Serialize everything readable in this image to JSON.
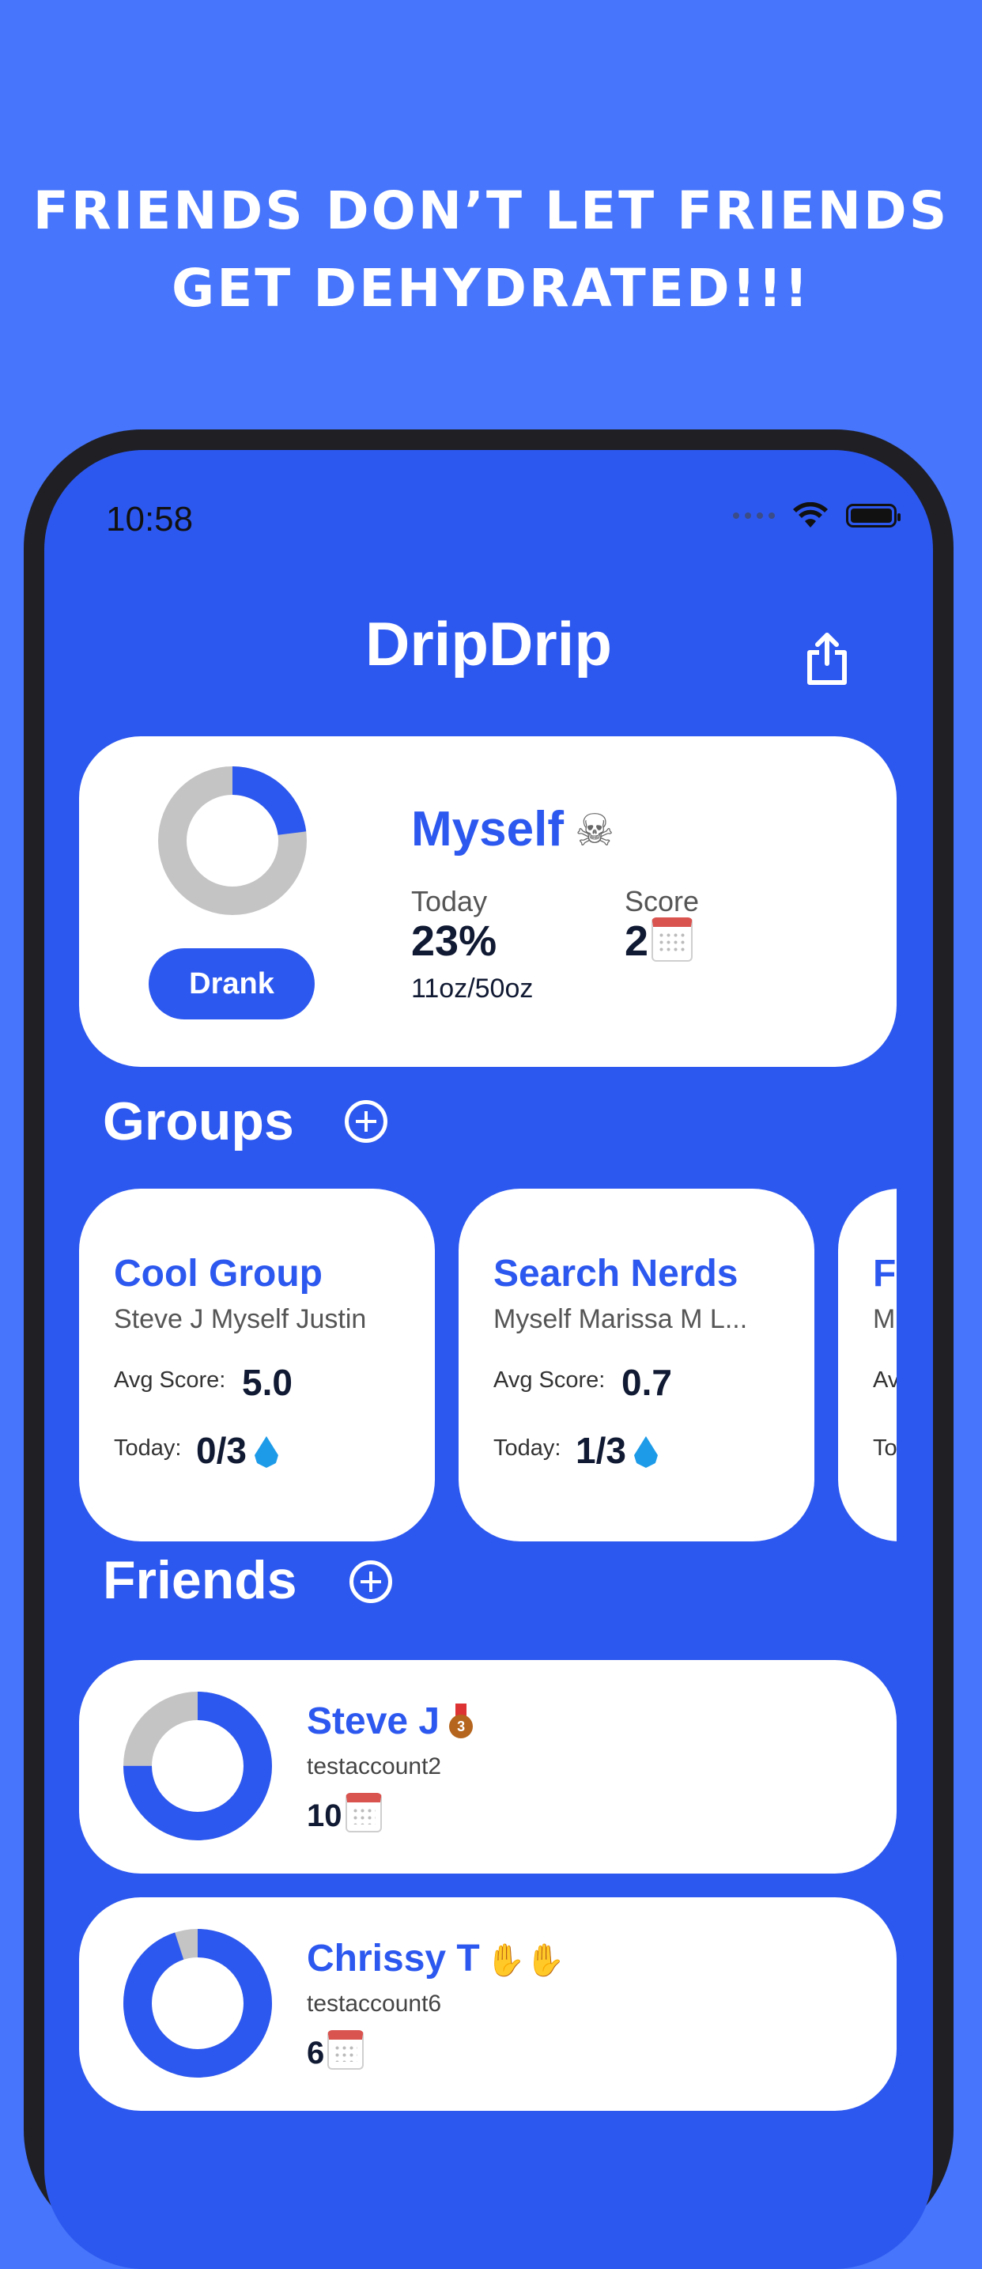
{
  "headline": {
    "line1": "FRIENDS DON’T LET FRIENDS",
    "line2": "GET DEHYDRATED!!!"
  },
  "status_bar": {
    "time": "10:58",
    "icons": [
      "signal-icon",
      "wifi-icon",
      "battery-icon"
    ]
  },
  "header": {
    "title": "DripDrip",
    "share_icon": "share-icon"
  },
  "me": {
    "name": "Myself",
    "emoji": "☠",
    "today_label": "Today",
    "today_percent": "23%",
    "today_progress": 0.23,
    "today_amount": "11oz/50oz",
    "score_label": "Score",
    "score_value": "2",
    "drank_button": "Drank"
  },
  "groups": {
    "title": "Groups",
    "items": [
      {
        "name": "Cool Group",
        "members": "Steve J Myself Justin",
        "avg_label": "Avg Score:",
        "avg": "5.0",
        "today_label": "Today:",
        "today": "0/3"
      },
      {
        "name": "Search Nerds",
        "members": "Myself Marissa M L...",
        "avg_label": "Avg Score:",
        "avg": "0.7",
        "today_label": "Today:",
        "today": "1/3"
      },
      {
        "name": "F",
        "members": "M",
        "avg_label": "Av",
        "avg": "",
        "today_label": "To",
        "today": ""
      }
    ]
  },
  "friends": {
    "title": "Friends",
    "items": [
      {
        "name": "Steve J",
        "username": "testaccount2",
        "score": "10",
        "progress": 0.75,
        "badge": "medal-icon"
      },
      {
        "name": "Chrissy T",
        "username": "testaccount6",
        "score": "6",
        "progress": 0.95,
        "badge": "clapping-hands-icon"
      }
    ]
  },
  "colors": {
    "background": "#4775fb",
    "screen": "#2d58ef",
    "accent": "#2d58ef",
    "ring_track": "#c4c4c4",
    "ring_fill": "#2d58ef"
  }
}
